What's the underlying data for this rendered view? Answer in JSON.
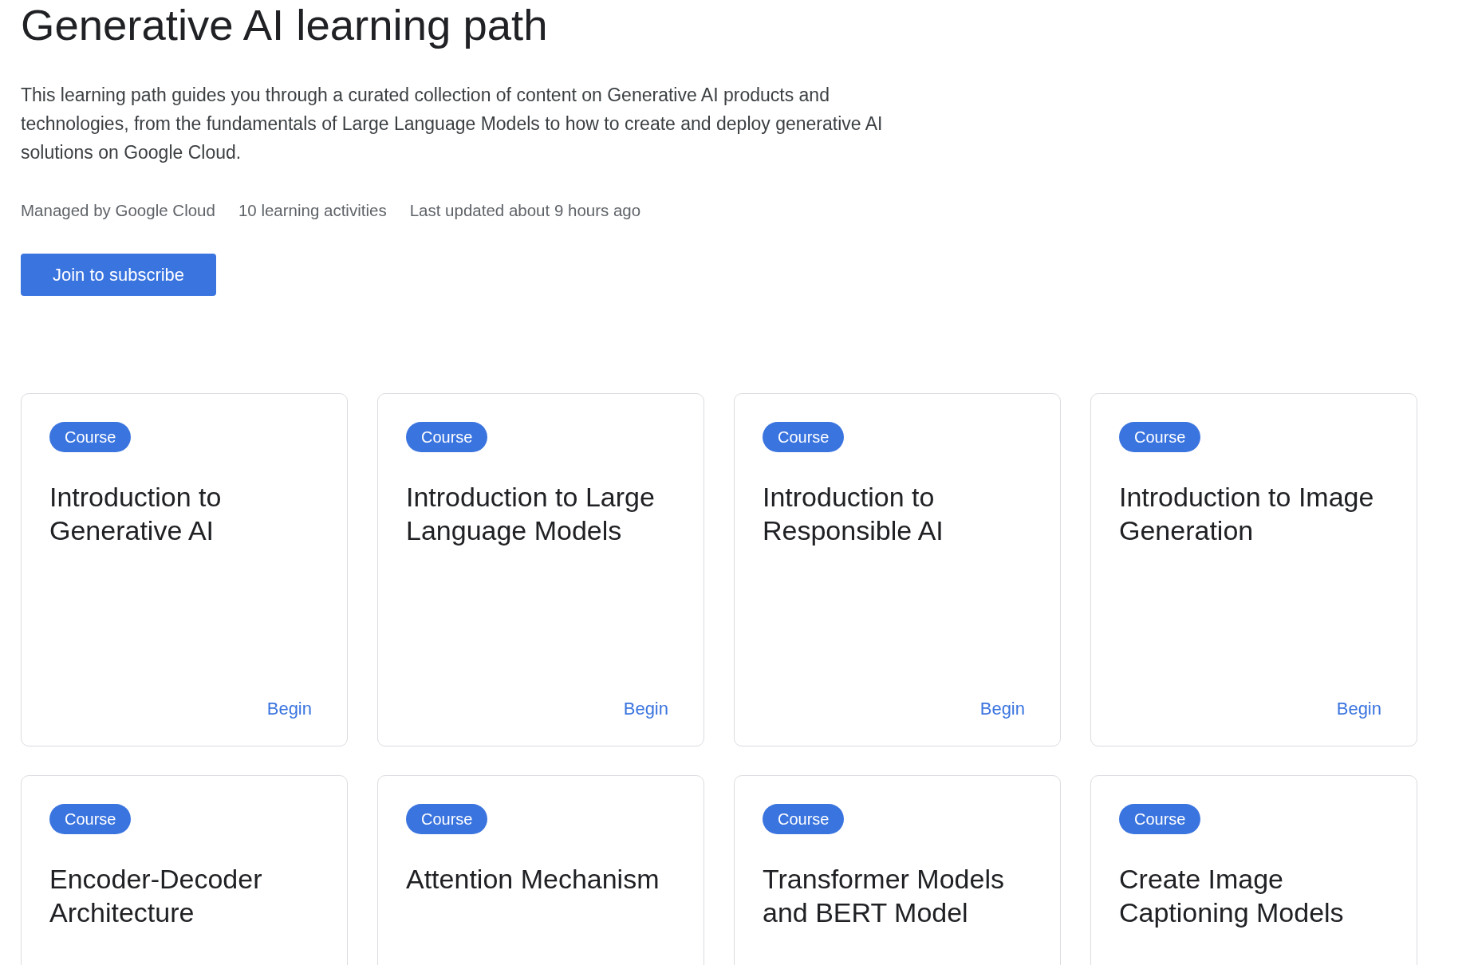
{
  "header": {
    "title": "Generative AI learning path",
    "description": "This learning path guides you through a curated collection of content on Generative AI products and technologies, from the fundamentals of Large Language Models to how to create and deploy generative AI solutions on Google Cloud.",
    "meta": [
      "Managed by Google Cloud",
      "10 learning activities",
      "Last updated about 9 hours ago"
    ],
    "subscribe_button": "Join to subscribe"
  },
  "activities": [
    {
      "type": "Course",
      "title": "Introduction to Generative AI",
      "action": "Begin"
    },
    {
      "type": "Course",
      "title": "Introduction to Large Language Models",
      "action": "Begin"
    },
    {
      "type": "Course",
      "title": "Introduction to Responsible AI",
      "action": "Begin"
    },
    {
      "type": "Course",
      "title": "Introduction to Image Generation",
      "action": "Begin"
    },
    {
      "type": "Course",
      "title": "Encoder-Decoder Architecture"
    },
    {
      "type": "Course",
      "title": "Attention Mechanism"
    },
    {
      "type": "Course",
      "title": "Transformer Models and BERT Model"
    },
    {
      "type": "Course",
      "title": "Create Image Captioning Models"
    }
  ]
}
